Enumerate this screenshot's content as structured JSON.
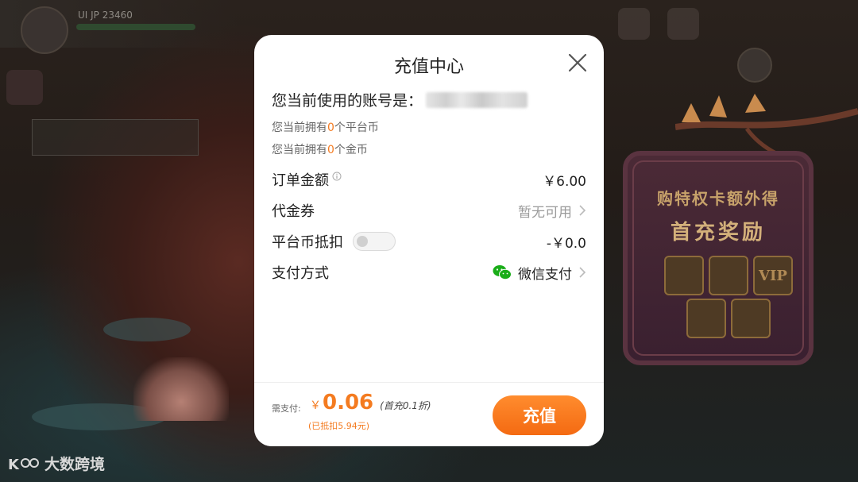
{
  "background": {
    "player_id": "UI JP 23460"
  },
  "promo": {
    "title": "购特权卡额外得",
    "subtitle": "首充奖励",
    "vip_label": "VIP"
  },
  "watermark": {
    "text": "大数跨境"
  },
  "modal": {
    "title": "充值中心",
    "account_label": "您当前使用的账号是：",
    "platform_coins": {
      "prefix": "您当前拥有",
      "count": "0",
      "suffix": "个平台币"
    },
    "gold_coins": {
      "prefix": "您当前拥有",
      "count": "0",
      "suffix": "个金币"
    },
    "order_amount": {
      "label": "订单金额",
      "value": "￥6.00"
    },
    "voucher": {
      "label": "代金券",
      "value": "暂无可用"
    },
    "platform_deduction": {
      "label": "平台币抵扣",
      "value": "-￥0.0",
      "toggle_on": false
    },
    "payment_method": {
      "label": "支付方式",
      "value": "微信支付"
    },
    "footer": {
      "pay_label": "需支付:",
      "currency": "￥",
      "amount": "0.06",
      "note": "(首充0.1折)",
      "deducted": "(已抵扣5.94元)",
      "recharge_button": "充值"
    }
  },
  "colors": {
    "accent": "#f47b20",
    "wechat": "#1aad19"
  }
}
